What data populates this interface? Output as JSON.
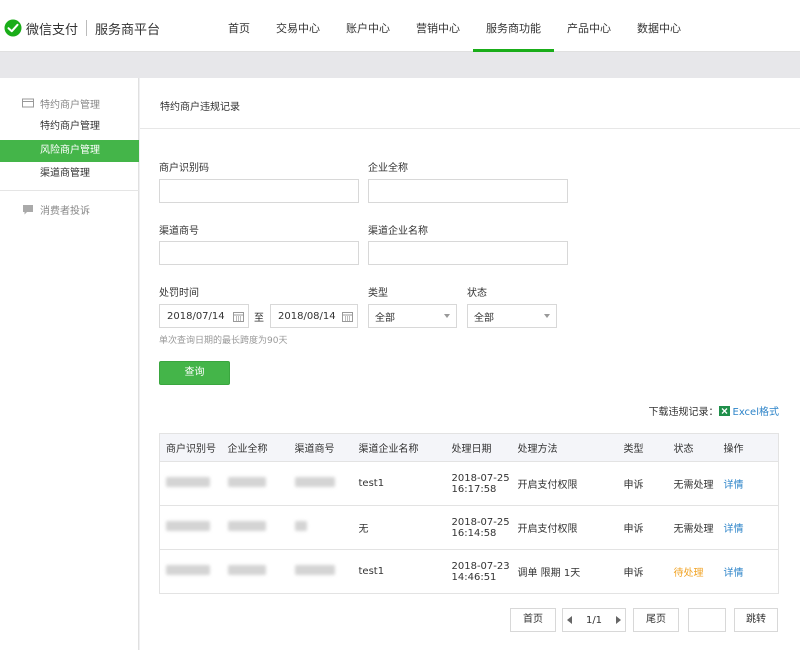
{
  "header": {
    "brand": "微信支付",
    "sub": "服务商平台",
    "nav": [
      "首页",
      "交易中心",
      "账户中心",
      "营销中心",
      "服务商功能",
      "产品中心",
      "数据中心"
    ],
    "active_nav": "服务商功能"
  },
  "sidebar": {
    "group1": "特约商户管理",
    "items": [
      "特约商户管理",
      "风险商户管理",
      "渠道商管理"
    ],
    "active_item": "风险商户管理",
    "group2": "消费者投诉"
  },
  "main": {
    "title": "特约商户违规记录",
    "form": {
      "merchant_id_label": "商户识别码",
      "company_name_label": "企业全称",
      "channel_id_label": "渠道商号",
      "channel_company_label": "渠道企业名称",
      "penalty_time_label": "处罚时间",
      "date_from": "2018/07/14",
      "date_sep": "至",
      "date_to": "2018/08/14",
      "type_label": "类型",
      "type_value": "全部",
      "status_label": "状态",
      "status_value": "全部",
      "hint": "单次查询日期的最长跨度为90天",
      "query_button": "查询"
    },
    "download_label": "下载违规记录：",
    "download_link": "Excel格式",
    "table": {
      "headers": [
        "商户识别号",
        "企业全称",
        "渠道商号",
        "渠道企业名称",
        "处理日期",
        "处理方法",
        "类型",
        "状态",
        "操作"
      ],
      "rows": [
        {
          "channel_company": "test1",
          "date": "2018-07-25",
          "time": "16:17:58",
          "method": "开启支付权限",
          "type": "申诉",
          "status": "无需处理",
          "action": "详情"
        },
        {
          "channel_company": "无",
          "date": "2018-07-25",
          "time": "16:14:58",
          "method": "开启支付权限",
          "type": "申诉",
          "status": "无需处理",
          "action": "详情"
        },
        {
          "channel_company": "test1",
          "date": "2018-07-23",
          "time": "14:46:51",
          "method": "调单 限期 1天",
          "type": "申诉",
          "status": "待处理",
          "action": "详情"
        }
      ]
    },
    "pager": {
      "first": "首页",
      "page": "1/1",
      "last": "尾页",
      "jump": "跳转"
    }
  },
  "colors": {
    "accent": "#44b549",
    "link": "#2d84c9",
    "pending": "#f1a325"
  }
}
